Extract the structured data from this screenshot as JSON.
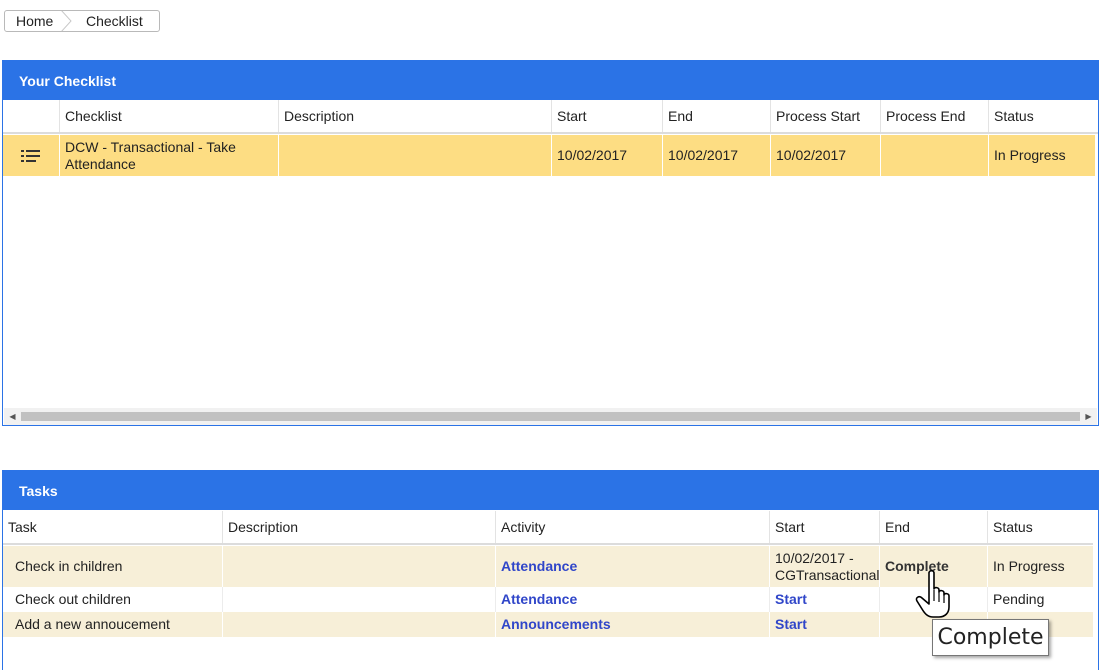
{
  "breadcrumb": {
    "items": [
      "Home",
      "Checklist"
    ]
  },
  "checklist_panel": {
    "title": "Your Checklist",
    "columns": [
      "",
      "Checklist",
      "Description",
      "Start",
      "End",
      "Process Start",
      "Process End",
      "Status"
    ],
    "rows": [
      {
        "icon": "list-icon",
        "checklist": "DCW - Transactional - Take Attendance",
        "description": "",
        "start": "10/02/2017",
        "end": "10/02/2017",
        "process_start": "10/02/2017",
        "process_end": "",
        "status": "In Progress"
      }
    ]
  },
  "tasks_panel": {
    "title": "Tasks",
    "columns": [
      "Task",
      "Description",
      "Activity",
      "Start",
      "End",
      "Status"
    ],
    "rows": [
      {
        "task": "Check in children",
        "description": "",
        "activity": "Attendance",
        "start": "10/02/2017 - CGTransactional",
        "end": "Complete",
        "status": "In Progress"
      },
      {
        "task": "Check out children",
        "description": "",
        "activity": "Attendance",
        "start": "Start",
        "end": "",
        "status": "Pending"
      },
      {
        "task": "Add a new annoucement",
        "description": "",
        "activity": "Announcements",
        "start": "Start",
        "end": "",
        "status": ""
      }
    ]
  },
  "tooltip": {
    "text": "Complete"
  },
  "colors": {
    "header_blue": "#2b73e6",
    "selected_row": "#fddd83",
    "alt_row": "#f7efd8",
    "link": "#3046c9"
  }
}
